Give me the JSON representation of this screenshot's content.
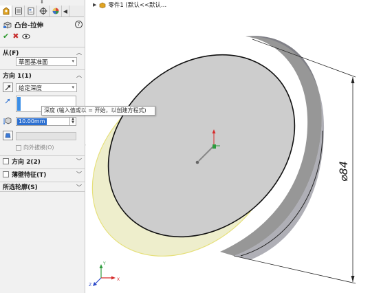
{
  "panel": {
    "tabs": [
      {
        "name": "feature-manager-icon",
        "active": true
      },
      {
        "name": "property-manager-icon",
        "active": false
      },
      {
        "name": "configuration-manager-icon",
        "active": false
      },
      {
        "name": "dimxpert-icon",
        "active": false
      },
      {
        "name": "display-manager-icon",
        "active": false
      }
    ],
    "tab_more": "◀",
    "grip": "⬍",
    "title": "凸台-拉伸",
    "help_label": "?",
    "ok_label": "✔",
    "cancel_label": "✖",
    "preview_label": "👁",
    "from_section": {
      "label": "从(F)",
      "value": "草图基准面"
    },
    "direction1_section": {
      "label": "方向 1(1)",
      "end_condition": "给定深度",
      "depth_value": "10.00mm",
      "draft_outward_label": "向外拔模(O)"
    },
    "tooltip": "深度 (输入值或以 = 开始，以创建方程式)",
    "direction2_section": {
      "label": "方向 2(2)"
    },
    "thin_feature_section": {
      "label": "薄壁特征(T)"
    },
    "selected_contours_section": {
      "label": "所选轮廓(S)"
    }
  },
  "viewport": {
    "breadcrumb_text": "零件1 (默认<<默认...",
    "dimension_label": "⌀84"
  },
  "colors": {
    "accent": "#2b6fd1",
    "ok": "#2e9a2e",
    "cancel": "#c62d2d",
    "preview_fill": "#eeeecc",
    "preview_edge": "#e6e07a",
    "face_gray": "#cdcdcd"
  }
}
